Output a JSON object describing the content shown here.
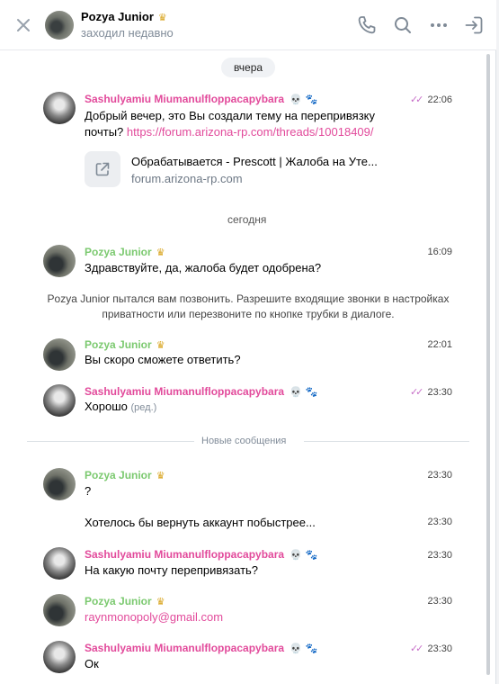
{
  "header": {
    "name": "Pozya Junior",
    "status": "заходил недавно"
  },
  "dates": {
    "yesterday": "вчера",
    "today": "сегодня"
  },
  "users": {
    "s": "Sashulyamiu Miumanulfloppacapybara",
    "p": "Pozya Junior"
  },
  "messages": [
    {
      "time": "22:06",
      "text_before_link": "Добрый вечер, это Вы создали тему на перепривязку почты? ",
      "link": "https://forum.arizona-rp.com/threads/10018409/"
    },
    {
      "time": "16:09",
      "text": "Здравствуйте, да, жалоба будет одобрена?"
    },
    {
      "time": "22:01",
      "text": "Вы скоро сможете ответить?"
    },
    {
      "time": "23:30",
      "text": "Хорошо",
      "edited": "(ред.)"
    },
    {
      "time": "23:30",
      "text": "?"
    },
    {
      "time": "23:30",
      "text": "Хотелось бы вернуть аккаунт побыстрее..."
    },
    {
      "time": "23:30",
      "text": "На какую почту перепривязать?"
    },
    {
      "time": "23:30",
      "text": "raynmonopoly@gmail.com"
    },
    {
      "time": "23:30",
      "text": "Ок"
    }
  ],
  "link_preview": {
    "title": "Обрабатывается - Prescott | Жалоба на Уте...",
    "host": "forum.arizona-rp.com"
  },
  "call_notice": "Pozya Junior пытался вам позвонить. Разрешите входящие звонки в настройках приватности или перезвоните по кнопке трубки в диалоге.",
  "new_messages_label": "Новые сообщения",
  "colors": {
    "pink": "#e24a9b",
    "green": "#7bc96f",
    "ticks": "#c76fc8"
  }
}
